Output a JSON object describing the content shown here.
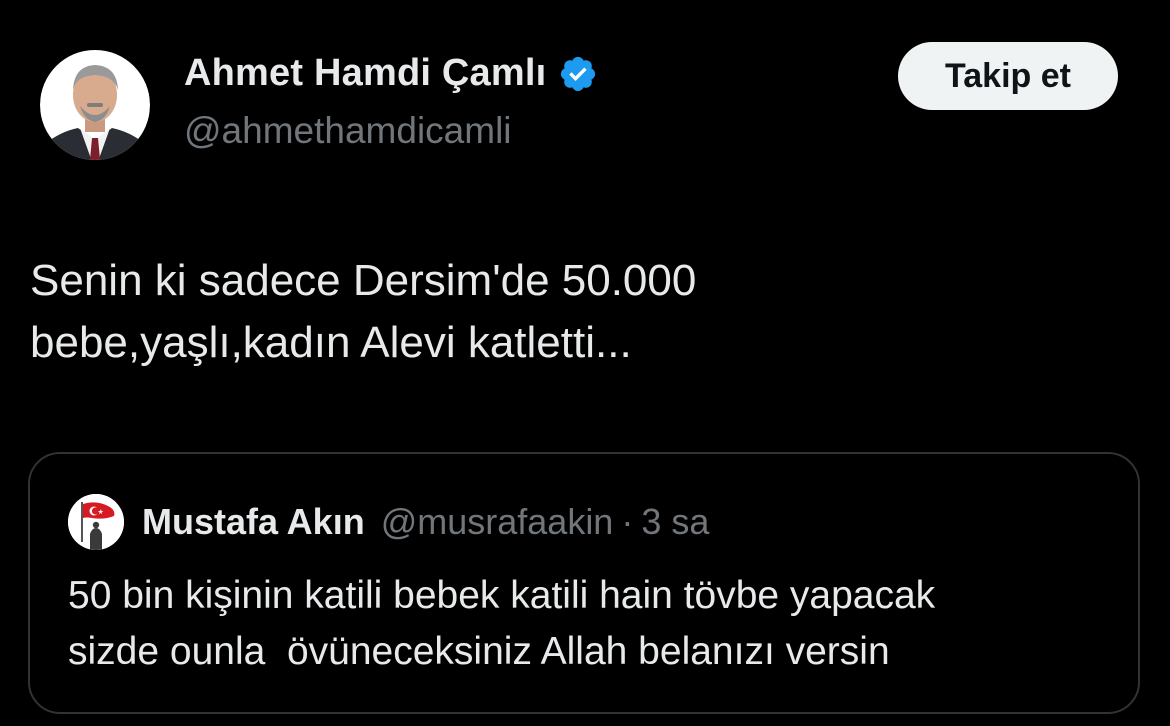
{
  "colors": {
    "background": "#000000",
    "text_primary": "#e7e9ea",
    "text_secondary": "#71767b",
    "verified_blue": "#1d9bf0",
    "follow_button_bg": "#eff3f4",
    "border": "#2f3336"
  },
  "author": {
    "display_name": "Ahmet Hamdi Çamlı",
    "handle": "@ahmethamdicamli",
    "verified_icon": "verified-badge-icon"
  },
  "follow_button": {
    "label": "Takip et"
  },
  "tweet": {
    "lines": [
      "Senin ki sadece Dersim'de 50.000",
      "bebe,yaşlı,kadın Alevi katletti..."
    ]
  },
  "quoted_tweet": {
    "display_name": "Mustafa Akın",
    "handle": "@musrafaakin",
    "separator": "·",
    "time": "3 sa",
    "lines": [
      "50 bin kişinin katili bebek katili hain tövbe yapacak",
      "sizde ounla  övüneceksiniz Allah belanızı versin"
    ]
  }
}
